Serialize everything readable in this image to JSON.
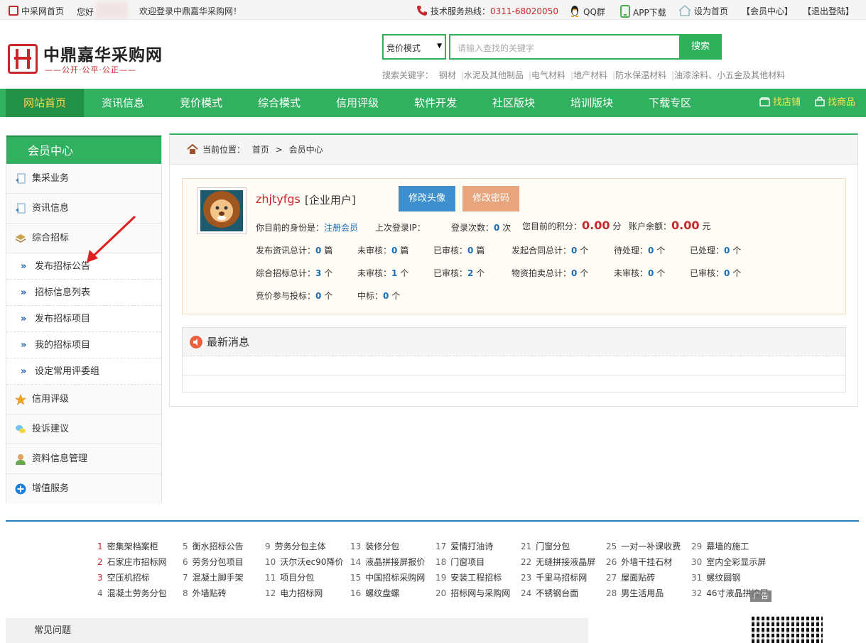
{
  "topbar": {
    "home_link": "中采网首页",
    "greeting": "您好",
    "welcome": "欢迎登录中鼎嘉华采购网！",
    "hotline_label": "技术服务热线：",
    "hotline_number": "0311-68020050",
    "qq_group": "QQ群",
    "app_download": "APP下载",
    "set_home": "设为首页",
    "member_center": "【会员中心】",
    "logout": "【退出登陆】"
  },
  "logo": {
    "title": "中鼎嘉华采购网",
    "tagline": "——公开·公平·公正——"
  },
  "search": {
    "mode": "竞价模式",
    "placeholder": "请输入查找的关键字",
    "button": "搜索",
    "keywords_label": "搜索关键字：",
    "keywords": [
      "钢材",
      "水泥及其他制品",
      "电气材料",
      "地产材料",
      "防水保温材料",
      "油漆涂料、小五金及其他材料"
    ]
  },
  "nav": {
    "items": [
      "网站首页",
      "资讯信息",
      "竞价模式",
      "综合模式",
      "信用评级",
      "软件开发",
      "社区版块",
      "培训版块",
      "下载专区"
    ],
    "find_shop": "找店铺",
    "find_goods": "找商品"
  },
  "sidebar": {
    "title": "会员中心",
    "items": {
      "procurement": "集采业务",
      "news": "资讯信息",
      "bidding": "综合招标",
      "credit": "信用评级",
      "complaint": "投诉建议",
      "profile": "资料信息管理",
      "value_added": "增值服务"
    },
    "sub_items": [
      "发布招标公告",
      "招标信息列表",
      "发布招标项目",
      "我的招标项目",
      "设定常用评委组"
    ]
  },
  "breadcrumb": {
    "label": "当前位置：",
    "home": "首页",
    "sep": ">",
    "current": "会员中心"
  },
  "profile": {
    "username": "zhjtyfgs",
    "user_type": "[企业用户]",
    "change_avatar": "修改头像",
    "change_password": "修改密码",
    "identity_label": "你目前的身份是：",
    "identity": "注册会员",
    "last_ip_label": "上次登录IP：",
    "login_count_label": "登录次数：",
    "login_count": "0",
    "login_count_unit": "次",
    "points_label": "您目前的积分：",
    "points": "0.00",
    "points_unit": "分",
    "balance_label": "账户余额：",
    "balance": "0.00",
    "balance_unit": "元"
  },
  "stats": [
    {
      "label": "发布资讯总计：",
      "value": "0",
      "unit": "篇"
    },
    {
      "label": "未审核：",
      "value": "0",
      "unit": "篇"
    },
    {
      "label": "已审核：",
      "value": "0",
      "unit": "篇"
    },
    {
      "label": "发起合同总计：",
      "value": "0",
      "unit": "个"
    },
    {
      "label": "待处理：",
      "value": "0",
      "unit": "个"
    },
    {
      "label": "已处理：",
      "value": "0",
      "unit": "个"
    },
    {
      "label": "综合招标总计：",
      "value": "3",
      "unit": "个"
    },
    {
      "label": "未审核：",
      "value": "1",
      "unit": "个"
    },
    {
      "label": "已审核：",
      "value": "2",
      "unit": "个"
    },
    {
      "label": "物资拍卖总计：",
      "value": "0",
      "unit": "个"
    },
    {
      "label": "未审核：",
      "value": "0",
      "unit": "个"
    },
    {
      "label": "已审核：",
      "value": "0",
      "unit": "个"
    },
    {
      "label": "竞价参与投标：",
      "value": "0",
      "unit": "个"
    },
    {
      "label": "中标：",
      "value": "0",
      "unit": "个"
    }
  ],
  "news": {
    "title": "最新消息"
  },
  "footer_links": [
    {
      "n": "1",
      "t": "密集架档案柜"
    },
    {
      "n": "2",
      "t": "石家庄市招标网"
    },
    {
      "n": "3",
      "t": "空压机招标"
    },
    {
      "n": "4",
      "t": "混凝土劳务分包"
    },
    {
      "n": "5",
      "t": "衡水招标公告"
    },
    {
      "n": "6",
      "t": "劳务分包项目"
    },
    {
      "n": "7",
      "t": "混凝土脚手架"
    },
    {
      "n": "8",
      "t": "外墙贴砖"
    },
    {
      "n": "9",
      "t": "劳务分包主体"
    },
    {
      "n": "10",
      "t": "沃尔沃ec90降价"
    },
    {
      "n": "11",
      "t": "项目分包"
    },
    {
      "n": "12",
      "t": "电力招标网"
    },
    {
      "n": "13",
      "t": "装修分包"
    },
    {
      "n": "14",
      "t": "液晶拼接屏报价"
    },
    {
      "n": "15",
      "t": "中国招标采购网"
    },
    {
      "n": "16",
      "t": "螺纹盘螺"
    },
    {
      "n": "17",
      "t": "爱情打油诗"
    },
    {
      "n": "18",
      "t": "门窗项目"
    },
    {
      "n": "19",
      "t": "安装工程招标"
    },
    {
      "n": "20",
      "t": "招标网与采购网"
    },
    {
      "n": "21",
      "t": "门窗分包"
    },
    {
      "n": "22",
      "t": "无缝拼接液晶屏"
    },
    {
      "n": "23",
      "t": "千里马招标网"
    },
    {
      "n": "24",
      "t": "不锈钢台面"
    },
    {
      "n": "25",
      "t": "一对一补课收费"
    },
    {
      "n": "26",
      "t": "外墙干挂石材"
    },
    {
      "n": "27",
      "t": "屋面贴砖"
    },
    {
      "n": "28",
      "t": "男生活用品"
    },
    {
      "n": "29",
      "t": "幕墙的施工"
    },
    {
      "n": "30",
      "t": "室内全彩显示屏"
    },
    {
      "n": "31",
      "t": "螺纹圆钢"
    },
    {
      "n": "32",
      "t": "46寸液晶拼接屏"
    }
  ],
  "ad_label": "广告",
  "faq": "常见问题",
  "colors": {
    "brand_green": "#31b15f",
    "brand_red": "#c8282d",
    "link_blue": "#1a6cb4"
  }
}
